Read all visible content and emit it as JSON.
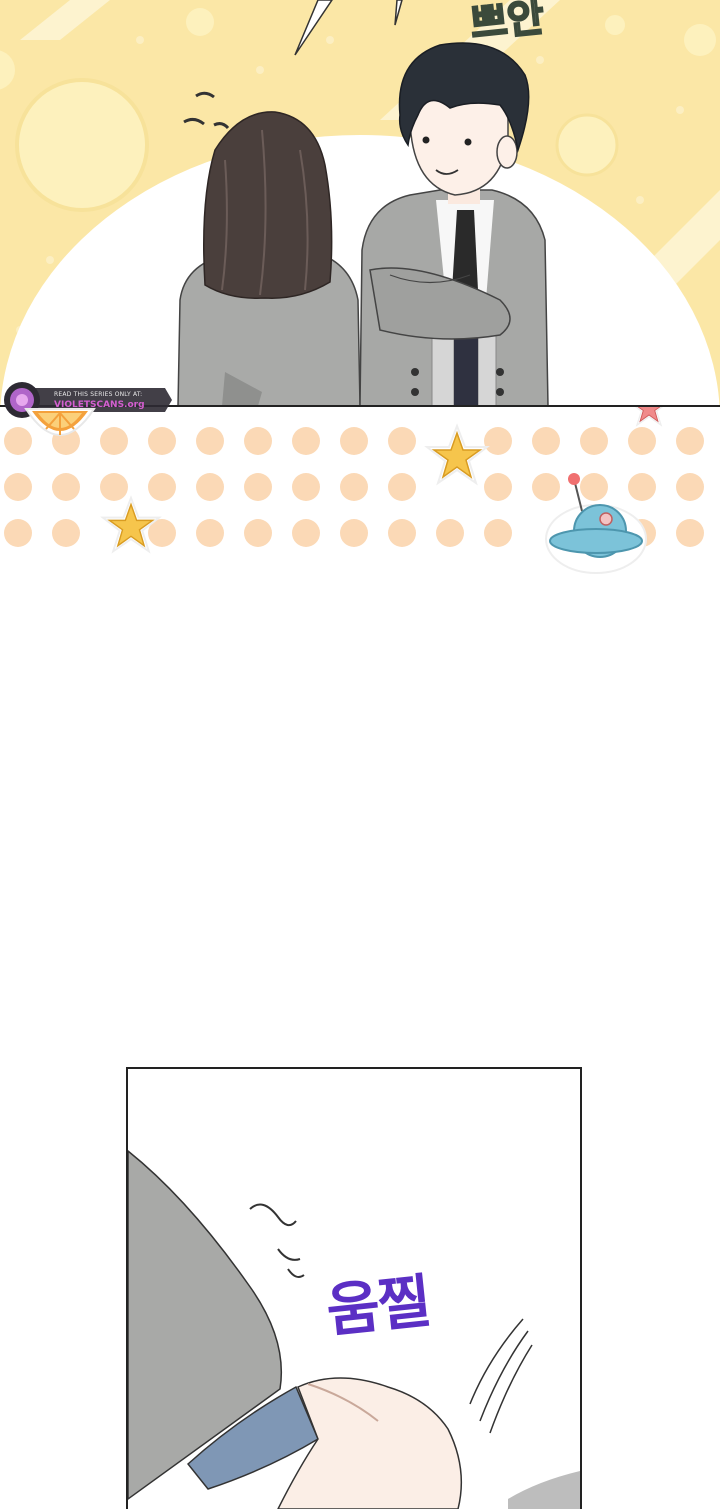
{
  "panel_top": {
    "sfx_text": "쁘안",
    "watermark": {
      "line1": "READ THIS SERIES ONLY AT:",
      "line2": "VIOLETSCANS.org"
    }
  },
  "panel_bottom": {
    "sfx_text": "움찔"
  },
  "colors": {
    "background_yellow": "#fbe7a6",
    "dot_peach": "#fbd9b6",
    "sfx_purple": "#5b2fc4",
    "panel_border": "#222222"
  }
}
